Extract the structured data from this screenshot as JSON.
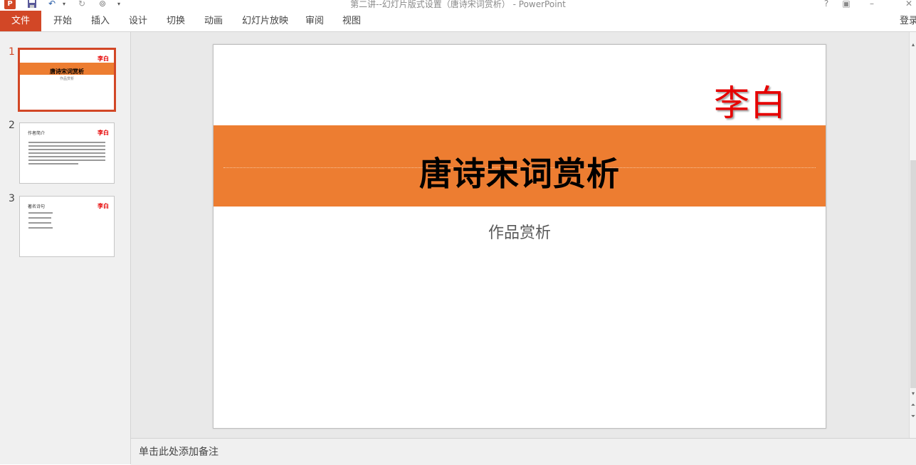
{
  "window": {
    "title": "第二讲--幻灯片版式设置（唐诗宋词赏析） - PowerPoint",
    "app_icon_label": "P",
    "controls": [
      "?",
      "▣",
      "–",
      "✕"
    ]
  },
  "ribbon": {
    "file_tab": "文件",
    "tabs": [
      "开始",
      "插入",
      "设计",
      "切换",
      "动画",
      "幻灯片放映",
      "审阅",
      "视图"
    ],
    "sign_in": "登录"
  },
  "thumbnails": [
    {
      "number": "1",
      "author": "李白",
      "title": "唐诗宋词赏析",
      "subtitle": "作品赏析",
      "active": true
    },
    {
      "number": "2",
      "author": "李白",
      "heading": "作者简介"
    },
    {
      "number": "3",
      "author": "李白",
      "heading": "著名诗句"
    }
  ],
  "slide": {
    "author": "李白",
    "title": "唐诗宋词赏析",
    "subtitle": "作品赏析"
  },
  "notes": {
    "placeholder": "单击此处添加备注"
  },
  "colors": {
    "accent": "#d24726",
    "title_band": "#ed7d31",
    "author_text": "#e60000"
  }
}
